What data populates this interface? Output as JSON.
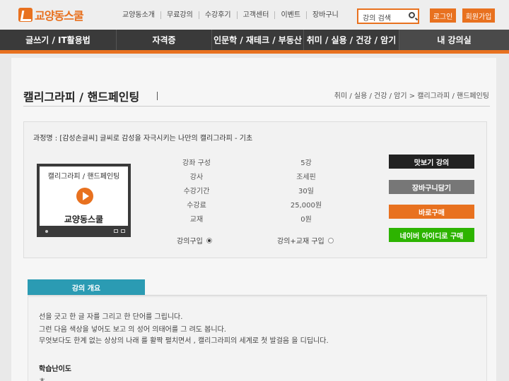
{
  "header": {
    "logo_text": "교양동스쿨",
    "top_menu": [
      "교양동소개",
      "무료강의",
      "수강후기",
      "고객센터",
      "이벤트",
      "장바구니"
    ],
    "search_placeholder": "강의 검색",
    "login_label": "로그인",
    "join_label": "회원가입"
  },
  "main_nav": [
    "글쓰기 / IT활용법",
    "자격증",
    "인문학 / 재테크 / 부동산",
    "취미 / 실용 / 건강 / 암기",
    "내 강의실"
  ],
  "page": {
    "title": "캘리그라피 / 핸드페인팅",
    "breadcrumb": "취미 / 실용 / 건강 / 암기 > 캘리그라피 / 핸드페인팅"
  },
  "course": {
    "name": "과정명 : [감성손글씨] 글씨로 감성을 자극시키는 나만의 캘리그라피 - 기초",
    "thumbnail": {
      "category": "캘리그라피 / 핸드페인팅",
      "brand": "교양동스쿨"
    },
    "info": [
      {
        "label": "강좌 구성",
        "value": "5강"
      },
      {
        "label": "강사",
        "value": "조세핀"
      },
      {
        "label": "수강기간",
        "value": "30일"
      },
      {
        "label": "수강료",
        "value": "25,000원"
      },
      {
        "label": "교재",
        "value": "0원"
      }
    ],
    "purchase_options": [
      {
        "label": "강의구입",
        "selected": true
      },
      {
        "label": "강의+교재 구입",
        "selected": false
      }
    ],
    "buttons": {
      "preview": "맛보기 강의",
      "cart": "장바구니담기",
      "buy": "바로구매",
      "naver": "네이버 아이디로 구매"
    }
  },
  "overview": {
    "tab_label": "강의 개요",
    "lines": [
      "선을 긋고 한 글 자를 그리고 한 단어를 그립니다.",
      "그런 다음 색상을 넣어도 보고 의 성어 의태어를 그 려도 봅니다.",
      "무엇보다도 한계 없는 상상의 나래 를 활짝 펼치면서 , 캘리그라피의 세계로 첫 발걸음 을 디딥니다."
    ],
    "level_title": "학습난이도",
    "level_value": "초"
  },
  "colors": {
    "accent": "#e8711f",
    "nav_bg": "#3a3a3a",
    "tab": "#2b9bb3",
    "naver": "#2db400"
  }
}
